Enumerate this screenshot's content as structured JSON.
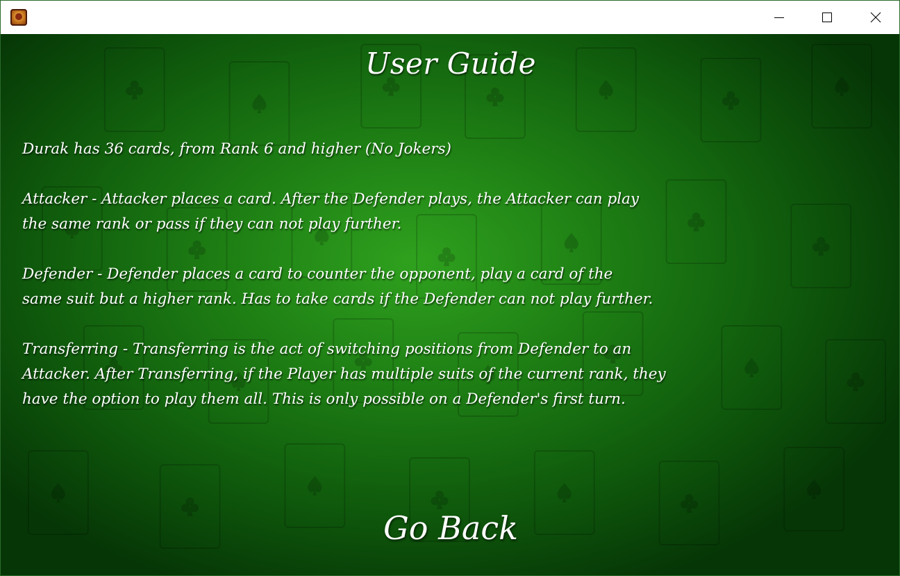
{
  "window": {
    "controls": {
      "minimize_icon": "minimize-icon",
      "maximize_icon": "maximize-icon",
      "close_icon": "close-icon"
    }
  },
  "screen": {
    "title": "User Guide",
    "paragraphs": [
      "Durak has 36 cards, from Rank 6 and higher (No Jokers)",
      "Attacker - Attacker places a card. After the Defender plays, the Attacker can play\nthe same rank or pass if they can not play further.",
      "Defender - Defender places a card to counter the opponent, play a card of the\nsame suit but a higher rank. Has to take cards if the Defender can not play further.",
      "Transferring - Transferring is the act of switching positions from Defender to an\nAttacker. After Transferring, if the Player has multiple suits of the current rank, they\nhave the option to play them all. This is only possible on a Defender's first turn."
    ],
    "go_back_label": "Go Back"
  },
  "colors": {
    "felt_center": "#2fa11e",
    "felt_edge": "#063606",
    "text": "#ffffff",
    "titlebar": "#ffffff"
  }
}
